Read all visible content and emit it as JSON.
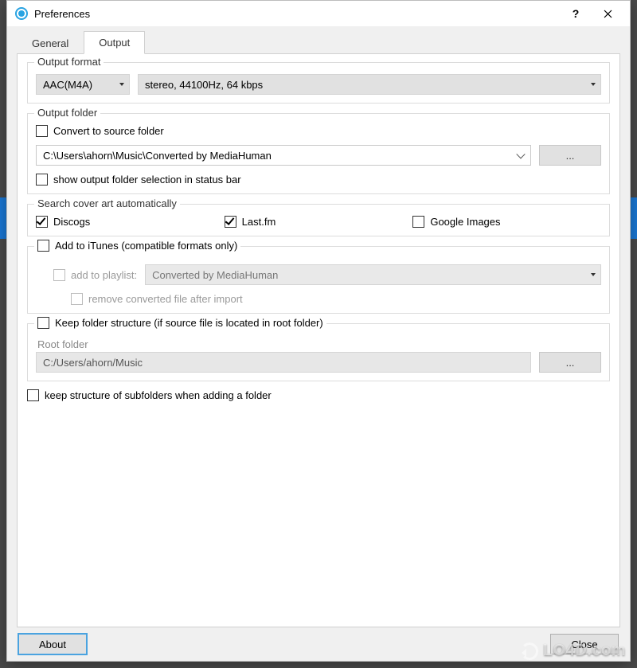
{
  "window": {
    "title": "Preferences"
  },
  "tabs": {
    "general": "General",
    "output": "Output"
  },
  "outputFormat": {
    "legend": "Output format",
    "codec": "AAC(M4A)",
    "profile": "stereo, 44100Hz, 64 kbps"
  },
  "outputFolder": {
    "legend": "Output folder",
    "convertToSource": "Convert to source folder",
    "path": "C:\\Users\\ahorn\\Music\\Converted by MediaHuman",
    "browse": "...",
    "showInStatusBar": "show output folder selection in status bar"
  },
  "coverArt": {
    "legend": "Search cover art automatically",
    "discogs": "Discogs",
    "lastfm": "Last.fm",
    "google": "Google Images"
  },
  "itunes": {
    "addToItunes": "Add to iTunes (compatible formats only)",
    "addToPlaylistLabel": "add to playlist:",
    "playlistName": "Converted by MediaHuman",
    "removeAfterImport": "remove converted file after import"
  },
  "keepStructure": {
    "label": "Keep folder structure (if source file is located in root folder)",
    "rootFolderLabel": "Root folder",
    "rootFolderPath": "C:/Users/ahorn/Music",
    "browse": "..."
  },
  "keepSubfolders": "keep structure of subfolders when adding a folder",
  "buttons": {
    "about": "About",
    "close": "Close"
  },
  "watermark": "LO4D.com"
}
